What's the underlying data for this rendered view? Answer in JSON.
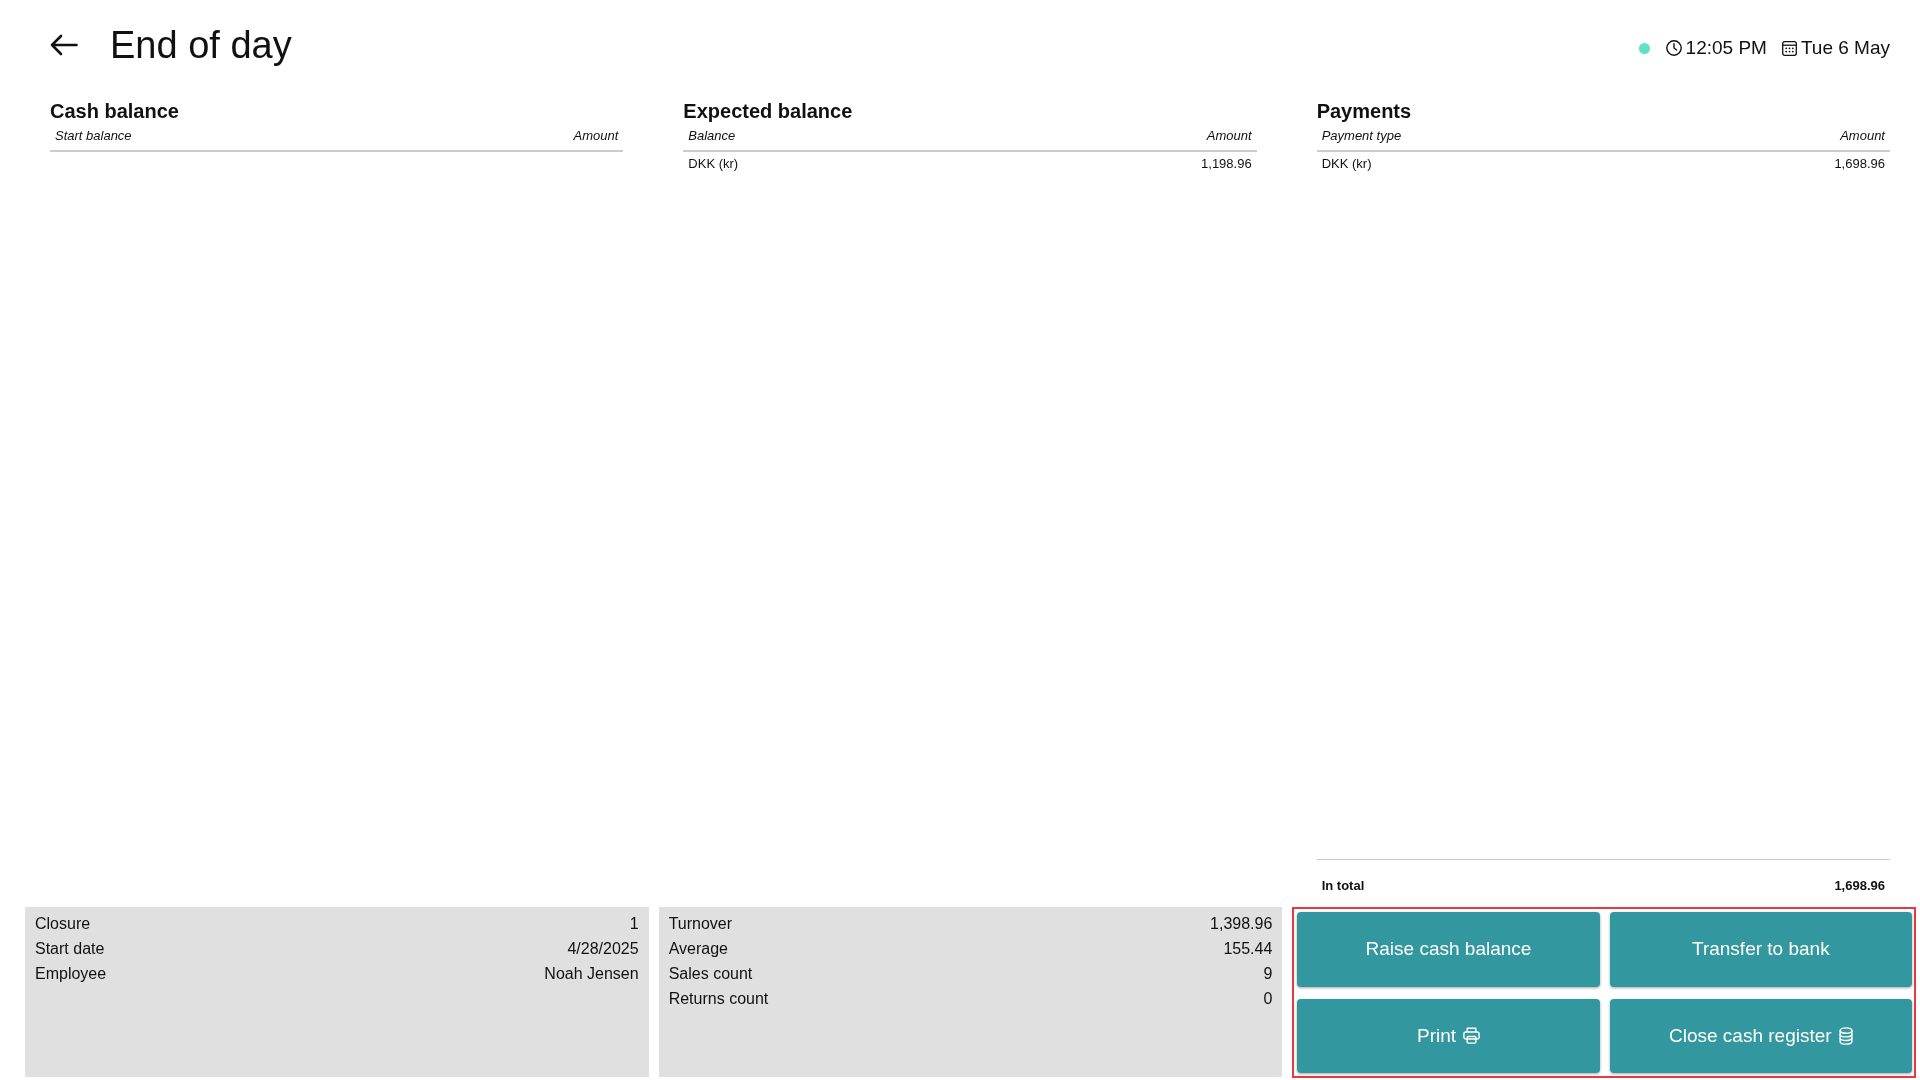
{
  "header": {
    "title": "End of day",
    "online": true,
    "time": "12:05 PM",
    "date": "Tue 6 May"
  },
  "tables": [
    {
      "title": "Cash balance",
      "columns": [
        "Start balance",
        "Amount"
      ]
    },
    {
      "title": "Expected balance",
      "columns": [
        "Balance",
        "Amount"
      ],
      "rows": [
        {
          "cells": [
            "DKK (kr)",
            "1,198.96"
          ]
        }
      ]
    },
    {
      "title": "Payments",
      "columns": [
        "Payment type",
        "Amount"
      ],
      "rows": [
        {
          "cells": [
            "DKK (kr)",
            "1,698.96"
          ]
        }
      ],
      "total": {
        "label": "In total",
        "value": "1,698.96"
      }
    }
  ],
  "summary_panels": [
    {
      "rows": [
        {
          "label": "Closure",
          "value": "1"
        },
        {
          "label": "Start date",
          "value": "4/28/2025"
        },
        {
          "label": "Employee",
          "value": "Noah Jensen"
        }
      ]
    },
    {
      "rows": [
        {
          "label": "Turnover",
          "value": "1,398.96"
        },
        {
          "label": "Average",
          "value": "155.44"
        },
        {
          "label": "Sales count",
          "value": "9"
        },
        {
          "label": "Returns count",
          "value": "0"
        }
      ]
    }
  ],
  "actions": {
    "highlighted": true,
    "buttons": [
      {
        "label": "Raise cash balance",
        "kind": "plain"
      },
      {
        "label": "Transfer to bank",
        "kind": "plain"
      },
      {
        "label": "Print",
        "kind": "print"
      },
      {
        "label": "Close cash register",
        "kind": "close"
      }
    ]
  }
}
